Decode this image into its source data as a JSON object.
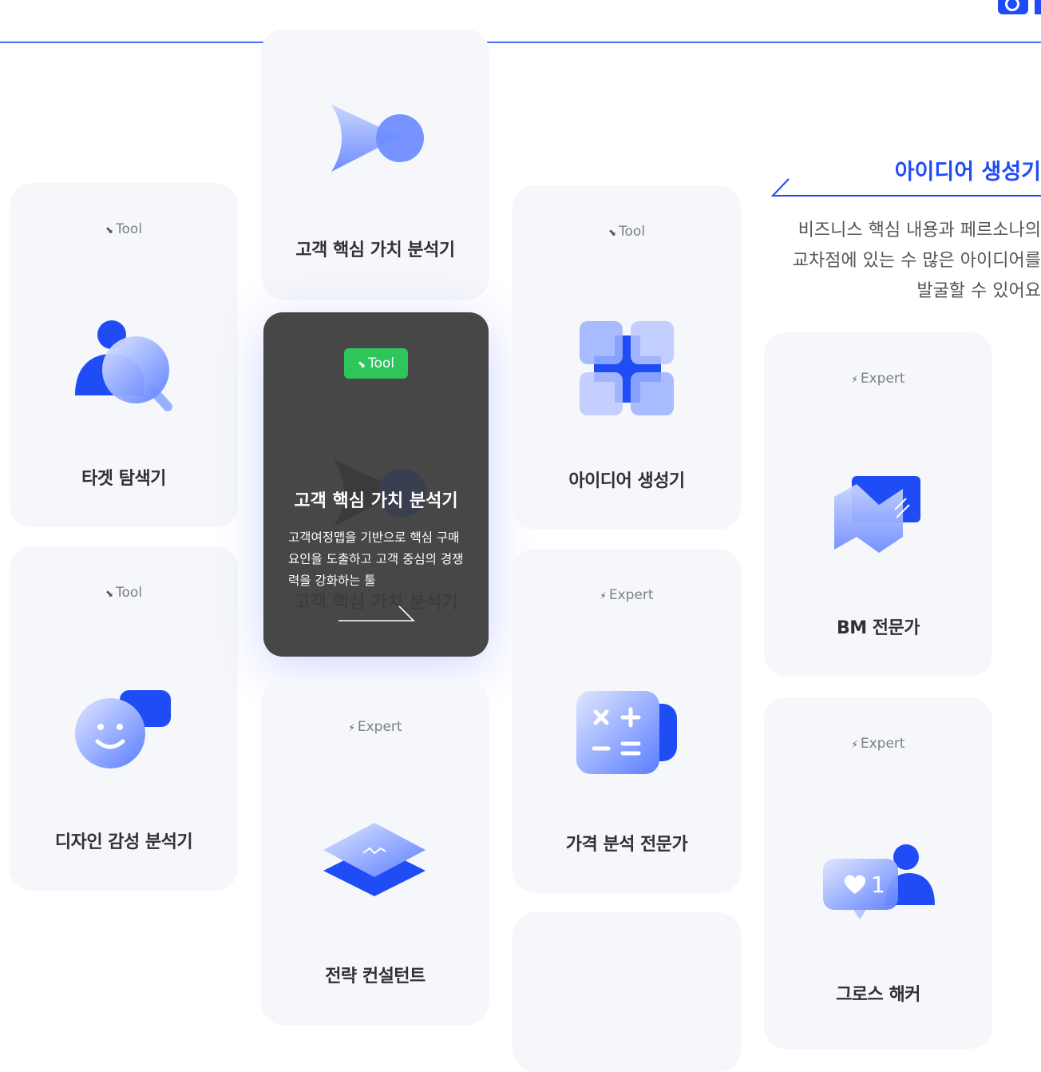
{
  "cards": {
    "target_finder": {
      "tag": "Tool",
      "title": "타겟 탐색기"
    },
    "design_analyzer": {
      "tag": "Tool",
      "title": "디자인 감성 분석기"
    },
    "value_analyzer_top": {
      "title": "고객 핵심 가치 분석기"
    },
    "value_analyzer_active": {
      "tag": "Tool",
      "title": "고객 핵심 가치 분석기",
      "description": "고객여정맵을 기반으로 핵심 구매 요인을 도출하고 고객 중심의 경쟁력을 강화하는 툴",
      "ghost_title": "고객 핵심 가치 분석기"
    },
    "strategy_consultant": {
      "tag": "Expert",
      "title": "전략 컨설턴트"
    },
    "idea_generator": {
      "tag": "Tool",
      "title": "아이디어 생성기"
    },
    "price_expert": {
      "tag": "Expert",
      "title": "가격 분석 전문가"
    },
    "bm_expert": {
      "tag": "Expert",
      "title": "BM 전문가"
    },
    "growth_hacker": {
      "tag": "Expert",
      "title": "그로스 해커",
      "like_count": "1"
    }
  },
  "side_panel": {
    "title": "아이디어 생성기",
    "description_lines": [
      "비즈니스 핵심 내용과 페르소나의",
      "교차점에 있는 수 많은 아이디어를",
      "발굴할 수 있어요"
    ]
  },
  "colors": {
    "accent": "#1f4cf5",
    "accent_light": "#9ab0ff",
    "card_bg": "#f6f7fa",
    "active_bg": "#474747",
    "badge": "#2ec55a"
  },
  "icons": {
    "tool": "tool-glyph",
    "expert": "bolt-glyph"
  }
}
